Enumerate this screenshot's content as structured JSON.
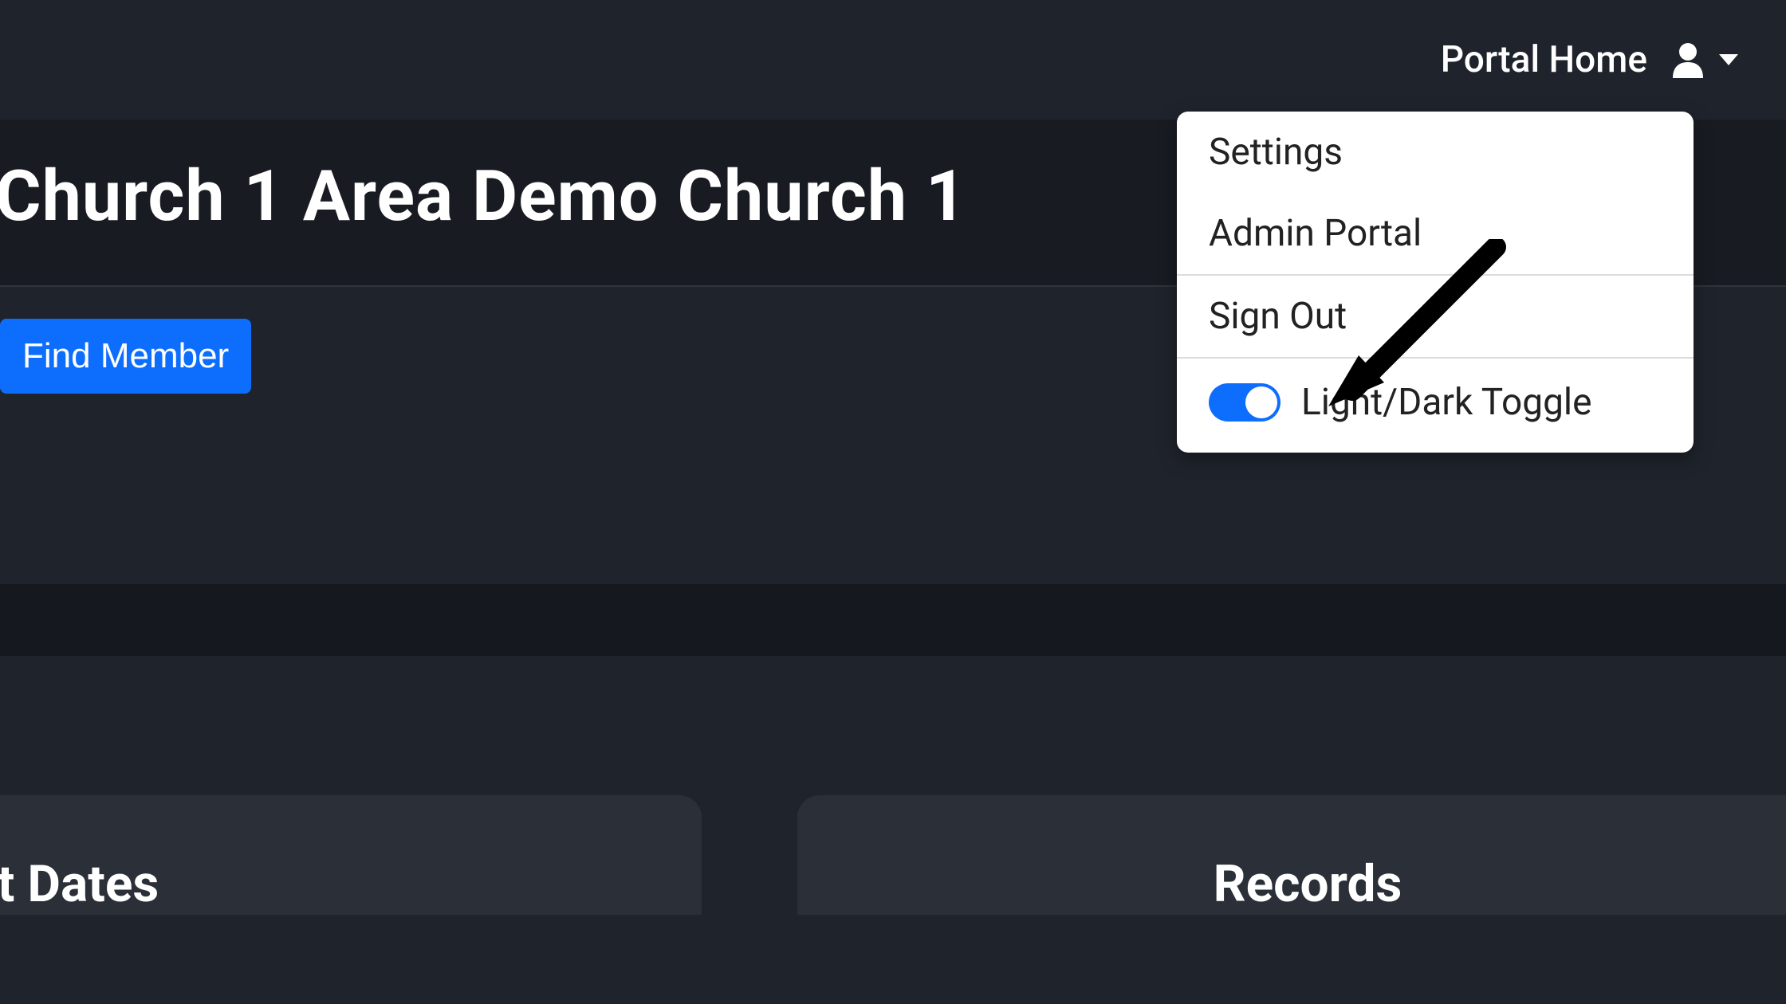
{
  "nav": {
    "portal_home": "Portal Home"
  },
  "page_title": "Church 1  Area Demo Church 1",
  "buttons": {
    "find_member": "Find Member"
  },
  "dropdown": {
    "settings": "Settings",
    "admin_portal": "Admin Portal",
    "sign_out": "Sign Out",
    "toggle_label": "Light/Dark Toggle",
    "toggle_on": true
  },
  "cards": {
    "left_title": "rtant Dates",
    "right_title": "Records"
  },
  "colors": {
    "accent": "#0d6efd",
    "bg_dark": "#1f232b"
  }
}
